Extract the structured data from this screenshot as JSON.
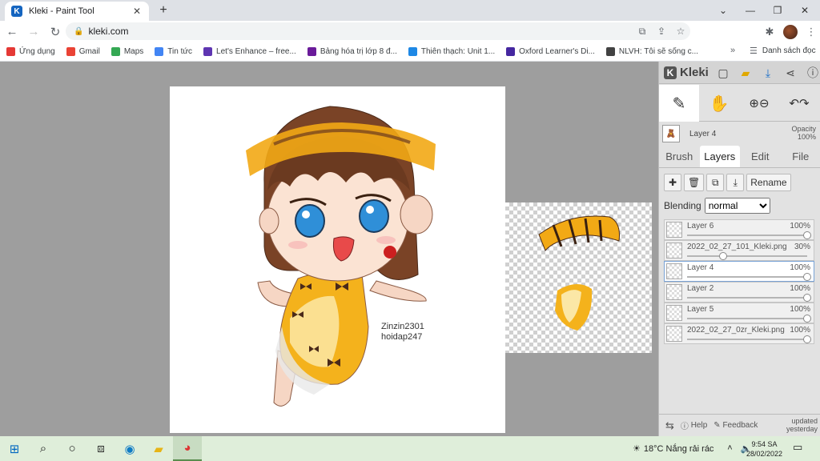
{
  "browser": {
    "tab_title": "Kleki - Paint Tool",
    "tab_favicon_letter": "K",
    "url": "kleki.com",
    "bookmarks": [
      {
        "label": "Ứng dụng",
        "color": "#e53935"
      },
      {
        "label": "Gmail",
        "color": "#ea4335"
      },
      {
        "label": "Maps",
        "color": "#34a853"
      },
      {
        "label": "Tin tức",
        "color": "#4285f4"
      },
      {
        "label": "Let's Enhance – free...",
        "color": "#5e35b1"
      },
      {
        "label": "Bảng hóa trị lớp 8 đ...",
        "color": "#6a1b9a"
      },
      {
        "label": "Thiên thạch: Unit 1...",
        "color": "#1e88e5"
      },
      {
        "label": "Oxford Learner's Di...",
        "color": "#4527a0"
      },
      {
        "label": "NLVH: Tôi sẽ sống c...",
        "color": "#424242"
      }
    ],
    "reading_list": "Danh sách đọc",
    "bookmarks_more": "»"
  },
  "canvas": {
    "signature_line1": "Zinzin2301",
    "signature_line2": "hoidap247"
  },
  "kleki": {
    "logo": "Kleki",
    "current_layer": "Layer 4",
    "opacity_label": "Opacity",
    "opacity_value": "100%",
    "tabs": [
      "Brush",
      "Layers",
      "Edit",
      "File"
    ],
    "active_tab": "Layers",
    "rename_label": "Rename",
    "blending_label": "Blending",
    "blending_value": "normal",
    "layers": [
      {
        "name": "Layer 6",
        "opacity": "100%",
        "level": 1.0,
        "active": false
      },
      {
        "name": "2022_02_27_101_Kleki.png",
        "opacity": "30%",
        "level": 0.3,
        "active": false
      },
      {
        "name": "Layer 4",
        "opacity": "100%",
        "level": 1.0,
        "active": true
      },
      {
        "name": "Layer 2",
        "opacity": "100%",
        "level": 1.0,
        "active": false
      },
      {
        "name": "Layer 5",
        "opacity": "100%",
        "level": 1.0,
        "active": false
      },
      {
        "name": "2022_02_27_0zr_Kleki.png",
        "opacity": "100%",
        "level": 1.0,
        "active": false
      }
    ],
    "help_label": "Help",
    "feedback_label": "Feedback",
    "updated_line1": "updated",
    "updated_line2": "yesterday"
  },
  "taskbar": {
    "weather_temp": "18°C",
    "weather_text": "Nắng rải rác",
    "time": "9:54 SA",
    "date": "28/02/2022"
  }
}
